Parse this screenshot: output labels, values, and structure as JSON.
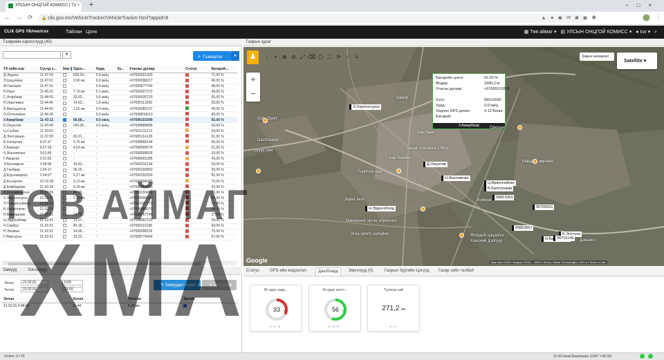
{
  "browser": {
    "tab_title": "УЛСЫН ОНЦГОЙ КОМИСС | Тэ",
    "url": "clix.gov.mn/VehicleTracker/VehicleTracker.html?appid=8"
  },
  "appbar": {
    "logo": "CLIX GPS Үйлчилгээ",
    "menu": [
      "Тайлан",
      "Цонх"
    ],
    "aimag": "Төв аймаг",
    "org": "УЛСЫН ОНЦГОЙ КОМИСС",
    "user": "tuv"
  },
  "left": {
    "header": "Тээврийн хэрэгслүүд (45)",
    "add_button": "Тээвэрлэх",
    "columns": [
      "ТХ нэйн нэр",
      "Сүүлд х...",
      "Зам",
      "Одоо...",
      "Хурд",
      "Ху...",
      "Утасны дугаар",
      "Статус",
      "Батарей..."
    ],
    "rows": [
      [
        "Д.Эрдэнэ",
        "11:47:24",
        "",
        "509,24...",
        "0.0 км/ц",
        "",
        "+97699021425",
        "#d9534f",
        "71,00 %"
      ],
      [
        "Э.Цэцэгмаа",
        "11:47:01",
        "",
        "0,92 км",
        "0,0 км/ц",
        "",
        "+97699090017",
        "#d9534f",
        "46,00 %"
      ],
      [
        "М.Ганзориг",
        "11:47:15",
        "",
        "-",
        "0.0 км/ц",
        "",
        "+97690677764",
        "#d9534f",
        "48,00 %"
      ],
      [
        "Н.Нарт",
        "11:45:22",
        "",
        "7,76 км",
        "0.1 км/ц",
        "",
        "+97699027372",
        "#d9534f",
        "44,00 %"
      ],
      [
        "С.Атарбаяр",
        "11:44:55",
        "",
        "32,63...",
        "0,6 км/ц",
        "",
        "+97699020720",
        "#d9534f",
        "65,00 %"
      ],
      [
        "Н.Уранчимэг",
        "11:44:46",
        "",
        "14,62...",
        "1.6 км/ц",
        "",
        "+97695113260",
        "#d9534f",
        "63,00 %"
      ],
      [
        "Б.Мөнхдэлгэр",
        "11:44:43",
        "",
        "1,02 км",
        "0,0 км/ц",
        "",
        "+97699082107",
        "#3c9d3c",
        "40,00 %"
      ],
      [
        "О.Отгончимэг",
        "11:44:28",
        "",
        "-",
        "0,0 км/ц",
        "",
        "+97698810013",
        "#d9534f",
        "45,00 %"
      ],
      [
        "У.Амарбаяр",
        "11:43:11",
        "",
        "69,08...",
        "0.0 км/ц",
        "",
        "+97699101699",
        "#d9534f",
        "92,00 %"
      ],
      [
        "Б.Оюунтөв",
        "11:43:49",
        "",
        "200,06...",
        "0.0 км/ц",
        "",
        "+97698888888",
        "#d9534f",
        "69,00 %"
      ],
      [
        "Ц.Сүхбаа",
        "11:29:53",
        "",
        "-",
        "-",
        "",
        "+97691211213",
        "#f0ad4e",
        "64,00 %"
      ],
      [
        "Д.Энхтүвшин",
        "11:22:28",
        "",
        "60,21...",
        "-",
        "",
        "+97695114128",
        "#d9534f",
        "91,00 %"
      ],
      [
        "Б.Халиунаа",
        "9:37:37",
        "",
        "3,76 км",
        "-",
        "",
        "+97698868184",
        "#d9534f",
        "96,00 %"
      ],
      [
        "Л.Баянаут",
        "9:27:18",
        "",
        "4,53 км",
        "-",
        "",
        "+97698689579",
        "#f0ad4e",
        "61,00 %"
      ],
      [
        "Ч.Жанчивлан",
        "3:01:56",
        "",
        "-",
        "-",
        "",
        "+97698568609",
        "#d9534f",
        "63,00 %"
      ],
      [
        "Г.Ажаргал",
        "2:31:03",
        "",
        "-",
        "-",
        "",
        "+97698991395",
        "#f0ad4e",
        "43,00 %"
      ],
      [
        "Э.Батжаргал",
        "1:58:58",
        "",
        "19,43...",
        "-",
        "",
        "+97690316144",
        "#d9534f",
        "63,00 %"
      ],
      [
        "Д.Ганбаар",
        "1:04:17",
        "",
        "36,25...",
        "-",
        "",
        "+97699160850",
        "#d9534f",
        "30,00 %"
      ],
      [
        "Д.Бүрэнжаргал",
        "1:04:07",
        "",
        "5,27 км",
        "-",
        "",
        "+97699153393",
        "#d9534f",
        "81,00 %"
      ],
      [
        "Д.Болортөгс",
        "22:15:38",
        "",
        "3,13 км",
        "-",
        "",
        "+97698896085",
        "#f0ad4e",
        "70,00 %"
      ],
      [
        "Д.Бямбадорж",
        "21:52:36",
        "",
        "6,39 км",
        "-",
        "",
        "+97699084840",
        "#d9534f",
        "52,00 %"
      ],
      [
        "Л.Зочнаржаргал",
        "21:37:55",
        "",
        "96,26...",
        "-",
        "",
        "+97699193456",
        "#d9534f",
        "72,00 %"
      ],
      [
        "З.Эрдэнэсүрэн",
        "21:02:01",
        "",
        "2,23 км",
        "-",
        "",
        "+97699095640",
        "#d9534f",
        "62,00 %"
      ],
      [
        "Э.Түвшинсайхан",
        "21:02:01",
        "",
        "-",
        "-",
        "",
        "+97691097773",
        "#d9534f",
        "77,00 %"
      ],
      [
        "Б.Хишигтөгөн",
        "21.02.01",
        "",
        "-",
        "-",
        "",
        "+97699089070",
        "#d9534f",
        "74,00 %"
      ],
      [
        "Н.Баваядорж",
        "21.02.01",
        "",
        "24,78...",
        "-",
        "",
        "+97699767145",
        "#d9534f",
        "27,00 %"
      ],
      [
        "Ц.Эрдэнэбаяр",
        "21.02.01",
        "",
        "13,57...",
        "-",
        "",
        "+97698897193",
        "#d9534f",
        "59,00 %"
      ],
      [
        "Ч.Самбуу",
        "21.02.01",
        "",
        "40,18...",
        "-",
        "",
        "+97699119196",
        "#d9534f",
        "94,00 %"
      ],
      [
        "Н.Энхмаа",
        "21.02.01",
        "",
        "14,96...",
        "-",
        "",
        "+97699098118",
        "#d9534f",
        "75,00 %"
      ],
      [
        "Г.Нямсүрэн",
        "21.02.01",
        "",
        "15,22...",
        "-",
        "",
        "+97698779404",
        "#d9534f",
        "67,00 %"
      ]
    ]
  },
  "schedule": {
    "tabs": [
      "Замууд",
      "Зогсолууд"
    ],
    "label_from": "Эхлэх",
    "label_to": "Тогтох",
    "date_from": "21.02.01",
    "time_from": "0:00",
    "date_to": "21.02.01",
    "time_to": "23:59",
    "report_button": "Замуудыг харах",
    "clear_button": "Цэвэрлэх",
    "columns": [
      "Эхлэл",
      "Эхлэл",
      "Төгсгөл",
      "Эргэлт"
    ],
    "row": [
      "21.02.01 9:48:04",
      "11:44",
      "6,90 км",
      ""
    ]
  },
  "map": {
    "header": "Газрын зураг",
    "zammer": "Замын анхаалал",
    "maptype": "Satellite",
    "google": "Google",
    "attrib": "Map data ©2021 Imagery ©2021 , CNES / Airbus, Maxar Technologies | 200 m | Terms of Use",
    "popup": {
      "labels": [
        "Батарейн цэнэг:",
        "Өндөр:",
        "Утасны дугаар:",
        "Хэлт:",
        "Хурд:",
        "Хөдлөх GPS дохио:",
        "Батарей:"
      ],
      "values": [
        "92,00 %",
        "1490,2 м",
        "+97699101696",
        "99101696",
        "0,0 км/ц",
        "4,12 Вольт",
        ""
      ],
      "name": "У.Амарбаяр"
    },
    "vehicles": [
      "Э.Хорлоосурэн",
      "Д.Оюунтөв",
      "Н.Жанчивлан",
      "Ц.Арвунсайхан",
      "Б.Билгүүнжав",
      "Н.Эрдэнэболд",
      "Н.Бадамдорж",
      "Б.Энхтуяа",
      "99813353",
      "99705551",
      "99863667",
      "99715149"
    ],
    "places": [
      "Satelit",
      "Gobi Sport",
      "Шүүх сум",
      "Dashvaanjil",
      "Зориг шоп",
      "Social Insurance Office",
      "Tuurhnol шоп",
      "Хан банк",
      "Хар бэхийн",
      "Манзушир эргэн хороолол",
      "Area sports complex",
      "Өгүүдэй цэцэрлэг",
      "Хүнсний дэлгүүр",
      "Оросын",
      "Дэвшил",
      "Мандал өмнийн",
      "Хүмүүн"
    ]
  },
  "bottom": {
    "tabs": [
      "Статус",
      "GPS-ийн мэдээлэл",
      "Дашбоард",
      "Зөрчлүүд (0)",
      "Газрын Зургийн Цэгүүд",
      "Газар зүйн талбай"
    ],
    "cards": [
      {
        "title": "Яг одоо хөдө...",
        "value": "33",
        "unit": "%",
        "color": "#d32f2f",
        "pct": 33
      },
      {
        "title": "Яг одоо зогсо...",
        "value": "56",
        "unit": "%",
        "color": "#2ecc40",
        "pct": 56
      },
      {
        "title": "Туулсан зай",
        "value": "271,2",
        "unit": "км",
        "color": "",
        "pct": 0
      }
    ]
  },
  "status": {
    "online": "Online: 9 / 45",
    "right": "11:49 Asia/Ulaanbaatar (GMT +08:00)"
  },
  "watermark": [
    "ТӨВ АЙМАГ",
    "ХМА"
  ]
}
